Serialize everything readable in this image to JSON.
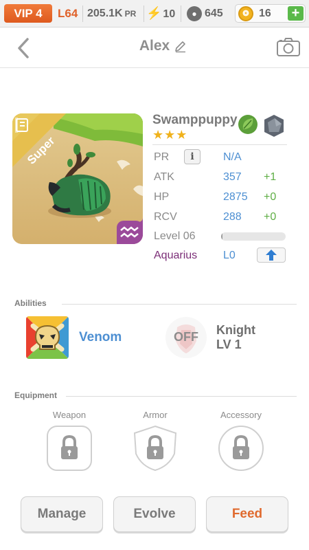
{
  "status_bar": {
    "vip": "VIP 4",
    "level": "L64",
    "power": "205.1K",
    "power_unit": "PR",
    "energy": "10",
    "paw_count": "645",
    "coins": "16",
    "icons": [
      "bolt-icon",
      "paw-icon",
      "coin-icon",
      "plus-icon"
    ]
  },
  "header": {
    "title": "Alex",
    "icons": [
      "back-chevron-icon",
      "edit-pencil-icon",
      "camera-icon"
    ]
  },
  "monster": {
    "badge": "Super",
    "name": "Swamppuppy",
    "stars": "★★★",
    "element_icons": [
      "leaf-icon",
      "rock-icon"
    ],
    "stats": [
      {
        "label": "PR",
        "value": "N/A",
        "bonus": ""
      },
      {
        "label": "ATK",
        "value": "357",
        "bonus": "+1"
      },
      {
        "label": "HP",
        "value": "2875",
        "bonus": "+0"
      },
      {
        "label": "RCV",
        "value": "288",
        "bonus": "+0"
      }
    ],
    "level_label": "Level 06",
    "level_progress": 0.02,
    "zodiac_label": "Aquarius",
    "zodiac_value": "L0"
  },
  "abilities": {
    "header": "Abilities",
    "primary": "Venom",
    "toggle": "OFF",
    "secondary_name": "Knight",
    "secondary_level": "LV 1"
  },
  "equipment": {
    "header": "Equipment",
    "slots": [
      "Weapon",
      "Armor",
      "Accessory"
    ]
  },
  "buttons": {
    "manage": "Manage",
    "evolve": "Evolve",
    "feed": "Feed"
  },
  "colors": {
    "accent_orange": "#e06a2e",
    "value_blue": "#4d8fd2",
    "bonus_green": "#5fae45",
    "zodiac_purple": "#7b2e77"
  }
}
